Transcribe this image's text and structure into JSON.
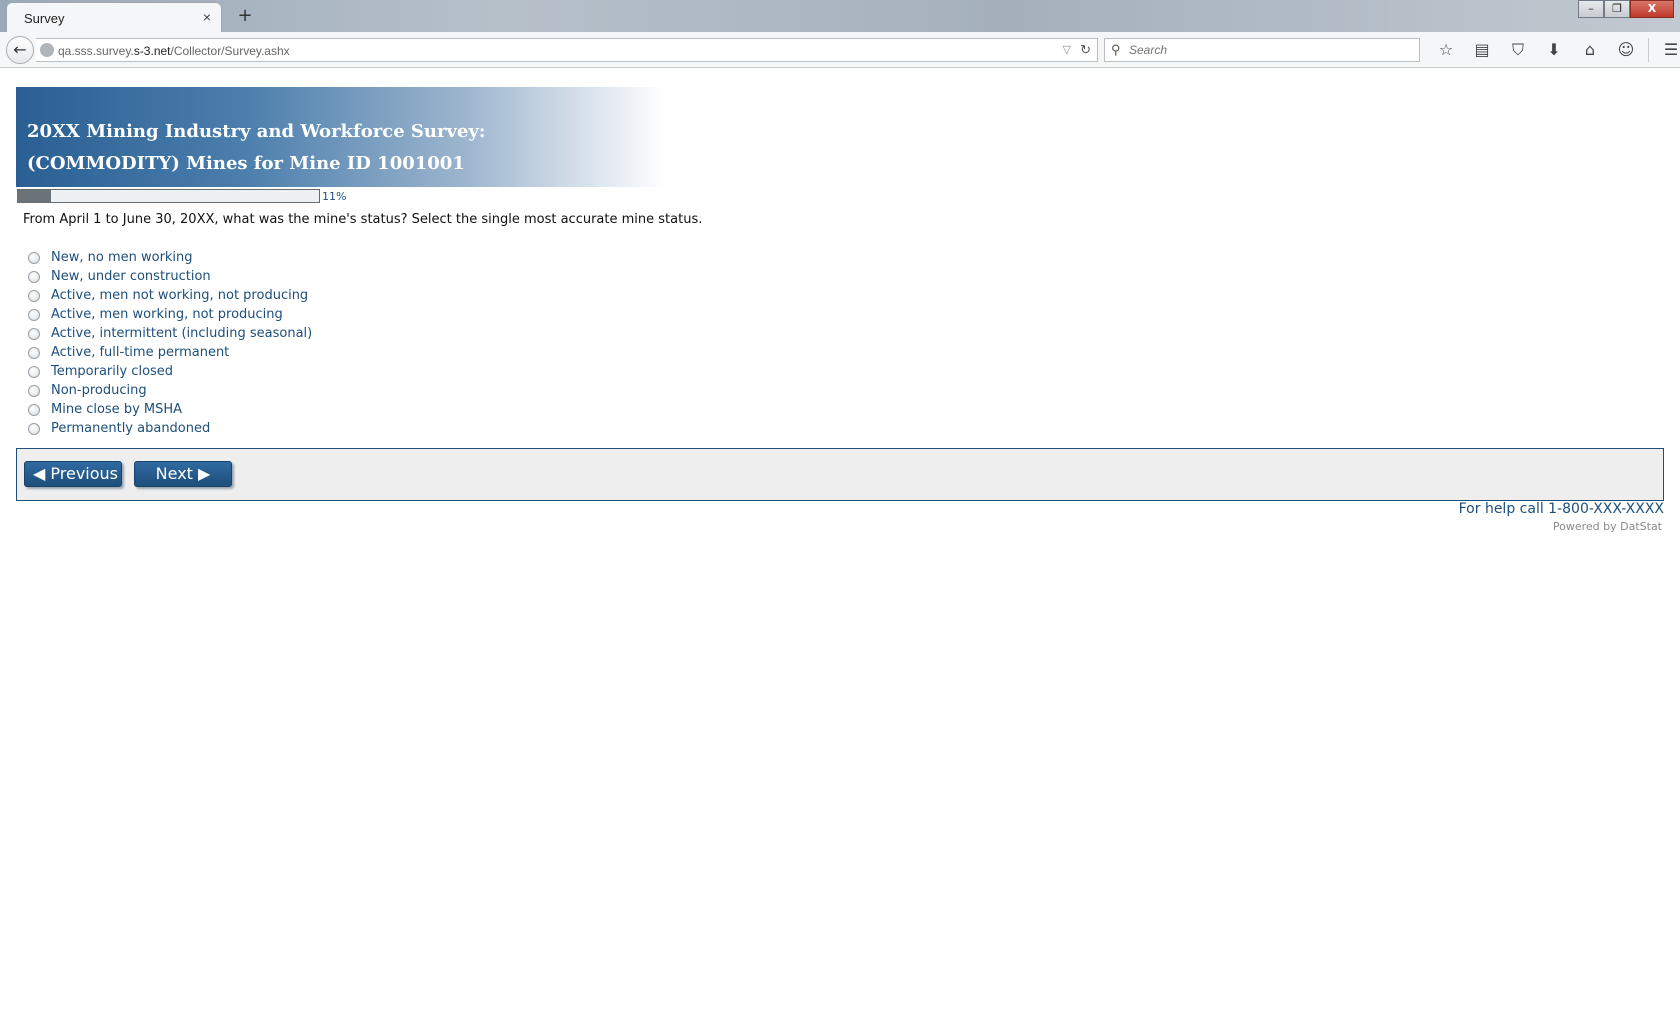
{
  "browser": {
    "tab_title": "Survey",
    "tab_close": "×",
    "new_tab": "+",
    "url_prefix": "qa.sss.survey.",
    "url_domain": "s-3.net",
    "url_path": "/Collector/Survey.ashx",
    "search_placeholder": "Search",
    "window_controls": {
      "minimize": "–",
      "maximize": "❐",
      "close": "X"
    },
    "toolbar_icons": [
      "star-icon",
      "reading-list-icon",
      "pocket-icon",
      "download-icon",
      "home-icon",
      "chat-icon",
      "menu-icon"
    ]
  },
  "survey": {
    "title_line1": "20XX Mining Industry and Workforce Survey:",
    "title_line2": "(COMMODITY) Mines for Mine ID 1001001",
    "progress_percent": 11,
    "progress_label": "11%",
    "question": "From April 1 to June 30, 20XX, what was the mine's status?  Select the single most accurate mine status.",
    "options": [
      "New, no men working",
      "New, under construction",
      "Active, men not working, not producing",
      "Active, men working, not producing",
      "Active, intermittent (including seasonal)",
      "Active, full-time permanent",
      "Temporarily closed",
      "Non-producing",
      "Mine close by MSHA",
      "Permanently abandoned"
    ],
    "previous_label": "◀ Previous",
    "next_label": "Next ▶",
    "help_text": "For help call 1-800-XXX-XXXX",
    "powered_by": "Powered by DatStat"
  },
  "colors": {
    "brand_blue": "#1e4f7a",
    "banner_start": "#2a5f93",
    "panel_bg": "#eeeeee"
  }
}
